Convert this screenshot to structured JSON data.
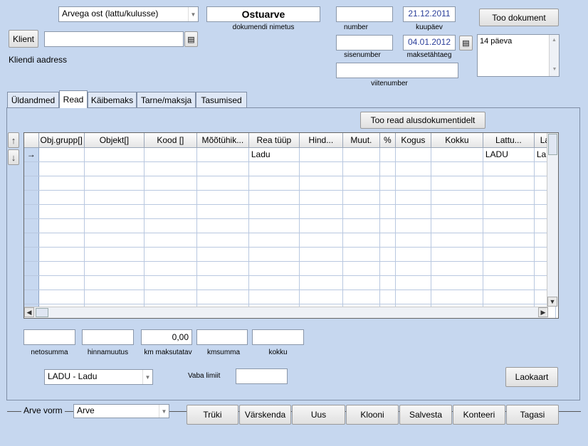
{
  "header": {
    "doc_type_select": "Arvega ost (lattu/kulusse)",
    "doc_title": "Ostuarve",
    "doc_title_caption": "dokumendi nimetus",
    "number_value": "",
    "number_caption": "number",
    "date_value": "21.12.2011",
    "date_caption": "kuupäev",
    "fetch_doc_button": "Too dokument",
    "client_button": "Klient",
    "client_value": "",
    "client_address_label": "Kliendi aadress",
    "internal_number_value": "",
    "internal_number_caption": "sisenumber",
    "due_date_value": "04.01.2012",
    "due_date_caption": "maksetähtaeg",
    "payment_terms": "14 päeva",
    "reference_value": "",
    "reference_caption": "viitenumber"
  },
  "tabs": [
    {
      "label": "Üldandmed",
      "active": false
    },
    {
      "label": "Read",
      "active": true
    },
    {
      "label": "Käibemaks",
      "active": false
    },
    {
      "label": "Tarne/maksja",
      "active": false
    },
    {
      "label": "Tasumised",
      "active": false
    }
  ],
  "rows_panel": {
    "fetch_rows_button": "Too read alusdokumentidelt",
    "columns": [
      "Obj.grupp[]",
      "Objekt[]",
      "Kood []",
      "Mõõtühik...",
      "Rea tüüp",
      "Hind...",
      "Muut.",
      "%",
      "Kogus",
      "Kokku",
      "Lattu...",
      "La"
    ],
    "rows": [
      [
        "",
        "",
        "",
        "",
        "Ladu",
        "",
        "",
        "",
        "",
        "",
        "LADU",
        "La"
      ]
    ],
    "current_row_marker": "→",
    "move_up_icon": "arrow-up-icon",
    "move_down_icon": "arrow-down-icon"
  },
  "totals": {
    "net_sum_value": "",
    "net_sum_caption": "netosumma",
    "price_change_value": "",
    "price_change_caption": "hinnamuutus",
    "vat_taxable_value": "0,00",
    "vat_taxable_caption": "km maksutatav",
    "vat_sum_value": "",
    "vat_sum_caption": "kmsumma",
    "total_value": "",
    "total_caption": "kokku"
  },
  "warehouse": {
    "select_value": "LADU - Ladu",
    "free_limit_label": "Vaba limiit",
    "free_limit_value": "",
    "stock_card_button": "Laokaart"
  },
  "footer": {
    "invoice_form_label": "Arve vorm",
    "invoice_form_value": "Arve",
    "buttons": [
      "Trüki",
      "Värskenda",
      "Uus",
      "Klooni",
      "Salvesta",
      "Konteeri",
      "Tagasi"
    ]
  }
}
